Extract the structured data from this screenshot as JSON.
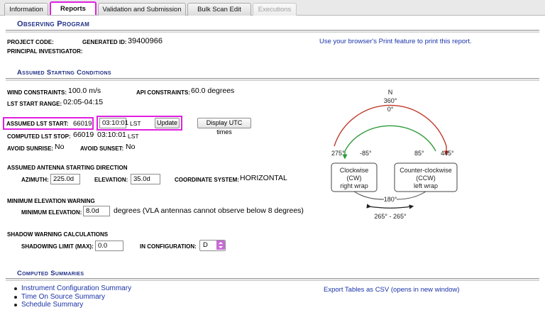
{
  "tabs": [
    {
      "label": "Information"
    },
    {
      "label": "Reports"
    },
    {
      "label": "Validation and Submission"
    },
    {
      "label": "Bulk Scan Edit"
    },
    {
      "label": "Executions"
    }
  ],
  "observing": {
    "title": "Observing Program",
    "project_code_label": "Project code:",
    "generated_id_label": "Generated ID:",
    "generated_id": "39400966",
    "pi_label": "Principal Investigator:",
    "print_note": "Use your browser's Print feature to print this report."
  },
  "conditions": {
    "title": "Assumed Starting Conditions",
    "wind_label": "Wind constraints:",
    "wind_value": "100.0 m/s",
    "api_label": "API constraints:",
    "api_value": "60.0 degrees",
    "lst_range_label": "LST start range:",
    "lst_range_value": "02:05-04:15",
    "lst_start_label": "Assumed LST start:",
    "lst_start_day": "66019",
    "lst_start_time": "03:10:01",
    "lst_unit": "LST",
    "update_label": "Update",
    "utc_button_label": "Display UTC times",
    "lst_stop_label": "Computed LST stop:",
    "lst_stop_day": "66019",
    "lst_stop_time": "03:10:01",
    "lst_stop_unit": "LST",
    "avoid_sunrise_label": "Avoid sunrise:",
    "avoid_sunrise_value": "No",
    "avoid_sunset_label": "Avoid sunset:",
    "avoid_sunset_value": "No"
  },
  "antenna": {
    "title": "Assumed antenna starting direction",
    "azimuth_label": "Azimuth:",
    "azimuth_value": "225.0d",
    "elevation_label": "Elevation:",
    "elevation_value": "35.0d",
    "coord_label": "Coordinate system:",
    "coord_value": "HORIZONTAL"
  },
  "min_elev": {
    "title": "Minimum Elevation warning",
    "label": "Minimum elevation:",
    "value": "8.0d",
    "note": "degrees (VLA antennas cannot observe below 8 degrees)"
  },
  "shadow": {
    "title": "Shadow Warning Calculations",
    "limit_label": "Shadowing limit (max):",
    "limit_value": "0.0",
    "config_label": "In configuration:",
    "config_value": "D"
  },
  "summaries": {
    "title": "Computed Summaries",
    "items": [
      {
        "label": "Instrument Configuration Summary"
      },
      {
        "label": "Time On Source Summary"
      },
      {
        "label": "Schedule Summary"
      }
    ],
    "export_label": "Export Tables as CSV (opens in new window)"
  },
  "diagram": {
    "north": "N",
    "top_deg1": "360°",
    "top_deg2": "0°",
    "left_a": "275°",
    "left_b": "-85°",
    "right_a": "85°",
    "right_b": "445°",
    "cw_line1": "Clockwise",
    "cw_line2": "(CW)",
    "cw_line3": "right wrap",
    "ccw_line1": "Counter-clockwise",
    "ccw_line2": "(CCW)",
    "ccw_line3": "left wrap",
    "bottom_deg": "180°",
    "bottom_range": "265° - 265°",
    "colors": {
      "red": "#c0392b",
      "green": "#2e9a3a"
    }
  },
  "colors": {
    "accent": "#1f2f86",
    "link": "#1a33a8",
    "highlight": "#e020e0"
  }
}
